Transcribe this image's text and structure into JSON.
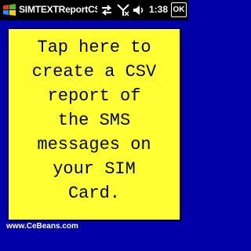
{
  "titlebar": {
    "app_title": "SIMTEXTReportCS",
    "time": "1:38",
    "ok_label": "OK",
    "icons": [
      "windows-flag-icon",
      "sync-arrows-icon",
      "signal-off-icon",
      "volume-icon"
    ]
  },
  "main": {
    "report_prompt": "Tap here to\ncreate a CSV\nreport of\nthe SMS\nmessages on\nyour SIM\nCard."
  },
  "footer": {
    "link_text": "www.CeBeans.com"
  },
  "colors": {
    "background": "#0000a8",
    "panel": "#ffff33",
    "titlebar": "#000000"
  }
}
